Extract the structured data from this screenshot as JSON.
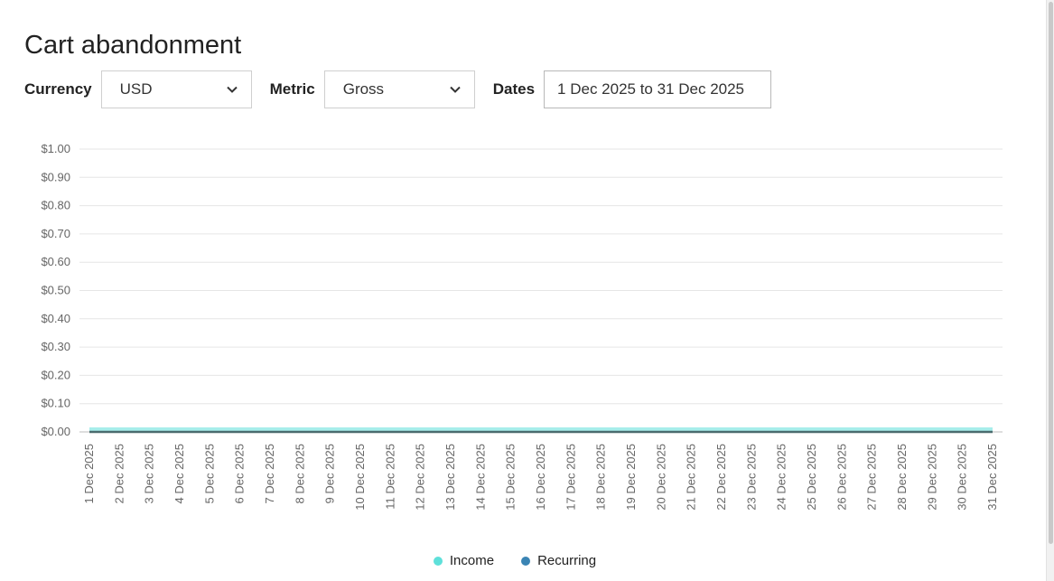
{
  "page": {
    "title": "Cart abandonment"
  },
  "filters": {
    "currency_label": "Currency",
    "currency_value": "USD",
    "metric_label": "Metric",
    "metric_value": "Gross",
    "dates_label": "Dates",
    "dates_value": "1 Dec 2025 to 31 Dec 2025"
  },
  "legend": {
    "items": [
      {
        "label": "Income",
        "color": "#5ee0da",
        "icon": "legend-dot-icon"
      },
      {
        "label": "Recurring",
        "color": "#3a84b4",
        "icon": "legend-dot-icon"
      }
    ]
  },
  "chart_data": {
    "type": "area",
    "ylim": [
      0,
      1
    ],
    "y_ticks": [
      "$1.00",
      "$0.90",
      "$0.80",
      "$0.70",
      "$0.60",
      "$0.50",
      "$0.40",
      "$0.30",
      "$0.20",
      "$0.10",
      "$0.00"
    ],
    "y_tick_values": [
      1.0,
      0.9,
      0.8,
      0.7,
      0.6,
      0.5,
      0.4,
      0.3,
      0.2,
      0.1,
      0.0
    ],
    "categories": [
      "1 Dec 2025",
      "2 Dec 2025",
      "3 Dec 2025",
      "4 Dec 2025",
      "5 Dec 2025",
      "6 Dec 2025",
      "7 Dec 2025",
      "8 Dec 2025",
      "9 Dec 2025",
      "10 Dec 2025",
      "11 Dec 2025",
      "12 Dec 2025",
      "13 Dec 2025",
      "14 Dec 2025",
      "15 Dec 2025",
      "16 Dec 2025",
      "17 Dec 2025",
      "18 Dec 2025",
      "19 Dec 2025",
      "20 Dec 2025",
      "21 Dec 2025",
      "22 Dec 2025",
      "23 Dec 2025",
      "24 Dec 2025",
      "25 Dec 2025",
      "26 Dec 2025",
      "27 Dec 2025",
      "28 Dec 2025",
      "29 Dec 2025",
      "30 Dec 2025",
      "31 Dec 2025"
    ],
    "series": [
      {
        "name": "Income",
        "color": "#5ee0da",
        "values": [
          0,
          0,
          0,
          0,
          0,
          0,
          0,
          0,
          0,
          0,
          0,
          0,
          0,
          0,
          0,
          0,
          0,
          0,
          0,
          0,
          0,
          0,
          0,
          0,
          0,
          0,
          0,
          0,
          0,
          0,
          0
        ]
      },
      {
        "name": "Recurring",
        "color": "#3a84b4",
        "values": [
          0,
          0,
          0,
          0,
          0,
          0,
          0,
          0,
          0,
          0,
          0,
          0,
          0,
          0,
          0,
          0,
          0,
          0,
          0,
          0,
          0,
          0,
          0,
          0,
          0,
          0,
          0,
          0,
          0,
          0,
          0
        ]
      }
    ],
    "grid": true,
    "legend_position": "bottom"
  }
}
